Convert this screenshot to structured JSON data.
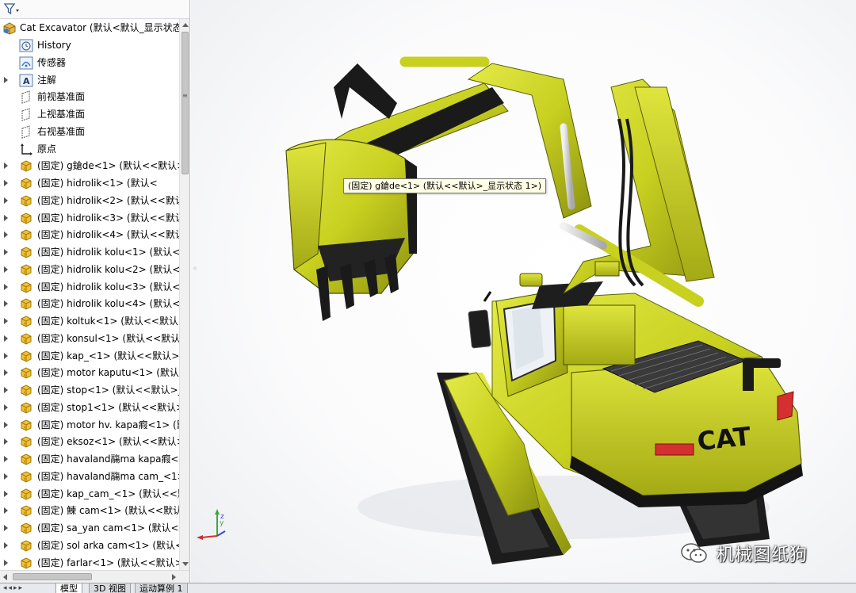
{
  "tree": {
    "root": {
      "label": "Cat Excavator  (默认<默认_显示状态"
    },
    "items": [
      {
        "label": "History",
        "icon": "history-icon",
        "expandable": false
      },
      {
        "label": "传感器",
        "icon": "sensor-icon",
        "expandable": false
      },
      {
        "label": "注解",
        "icon": "annotation-icon",
        "expandable": true
      },
      {
        "label": "前视基准面",
        "icon": "plane-icon",
        "expandable": false
      },
      {
        "label": "上视基准面",
        "icon": "plane-icon",
        "expandable": false
      },
      {
        "label": "右视基准面",
        "icon": "plane-icon",
        "expandable": false
      },
      {
        "label": "原点",
        "icon": "origin-icon",
        "expandable": false
      },
      {
        "label": "(固定) g鎗de<1> (默认<<默认>",
        "icon": "part-icon",
        "expandable": true
      },
      {
        "label": "(固定) hidrolik<1> (默认<",
        "icon": "part-icon",
        "expandable": true
      },
      {
        "label": "(固定) hidrolik<2> (默认<<默认",
        "icon": "part-icon",
        "expandable": true
      },
      {
        "label": "(固定) hidrolik<3> (默认<<默认",
        "icon": "part-icon",
        "expandable": true
      },
      {
        "label": "(固定) hidrolik<4> (默认<<默认",
        "icon": "part-icon",
        "expandable": true
      },
      {
        "label": "(固定) hidrolik kolu<1> (默认<",
        "icon": "part-icon",
        "expandable": true
      },
      {
        "label": "(固定) hidrolik kolu<2> (默认<",
        "icon": "part-icon",
        "expandable": true
      },
      {
        "label": "(固定) hidrolik kolu<3> (默认<",
        "icon": "part-icon",
        "expandable": true
      },
      {
        "label": "(固定) hidrolik kolu<4> (默认<",
        "icon": "part-icon",
        "expandable": true
      },
      {
        "label": "(固定) koltuk<1> (默认<<默认>",
        "icon": "part-icon",
        "expandable": true
      },
      {
        "label": "(固定) konsul<1> (默认<<默认>",
        "icon": "part-icon",
        "expandable": true
      },
      {
        "label": "(固定) kap_<1> (默认<<默认>_",
        "icon": "part-icon",
        "expandable": true
      },
      {
        "label": "(固定) motor kaputu<1> (默认<",
        "icon": "part-icon",
        "expandable": true
      },
      {
        "label": "(固定) stop<1> (默认<<默认>_显",
        "icon": "part-icon",
        "expandable": true
      },
      {
        "label": "(固定) stop1<1> (默认<<默认>_",
        "icon": "part-icon",
        "expandable": true
      },
      {
        "label": "(固定) motor hv. kapa瘕<1> (默",
        "icon": "part-icon",
        "expandable": true
      },
      {
        "label": "(固定) eksoz<1> (默认<<默认>",
        "icon": "part-icon",
        "expandable": true
      },
      {
        "label": "(固定) havaland鬺ma kapa瘕<1",
        "icon": "part-icon",
        "expandable": true
      },
      {
        "label": "(固定) havaland鬺ma cam_<1>",
        "icon": "part-icon",
        "expandable": true
      },
      {
        "label": "(固定) kap_cam_<1> (默认<<默",
        "icon": "part-icon",
        "expandable": true
      },
      {
        "label": "(固定) 鰊 cam<1> (默认<<默认:",
        "icon": "part-icon",
        "expandable": true
      },
      {
        "label": "(固定) sa_yan cam<1> (默认<<",
        "icon": "part-icon",
        "expandable": true
      },
      {
        "label": "(固定) sol arka cam<1> (默认<",
        "icon": "part-icon",
        "expandable": true
      },
      {
        "label": "(固定) farlar<1> (默认<<默认>_",
        "icon": "part-icon",
        "expandable": true
      }
    ]
  },
  "tooltip": {
    "text": "(固定) g鎗de<1> (默认<<默认>_显示状态 1>)"
  },
  "tabs": [
    {
      "label": "模型",
      "active": true
    },
    {
      "label": "3D 视图",
      "active": false
    },
    {
      "label": "运动算例 1",
      "active": false
    }
  ],
  "model": {
    "brand_text": "CAT",
    "body_color": "#c8d020",
    "dark_color": "#1a1a1a",
    "light_color": "#e03030"
  },
  "watermark": {
    "text": "机械图纸狗"
  }
}
